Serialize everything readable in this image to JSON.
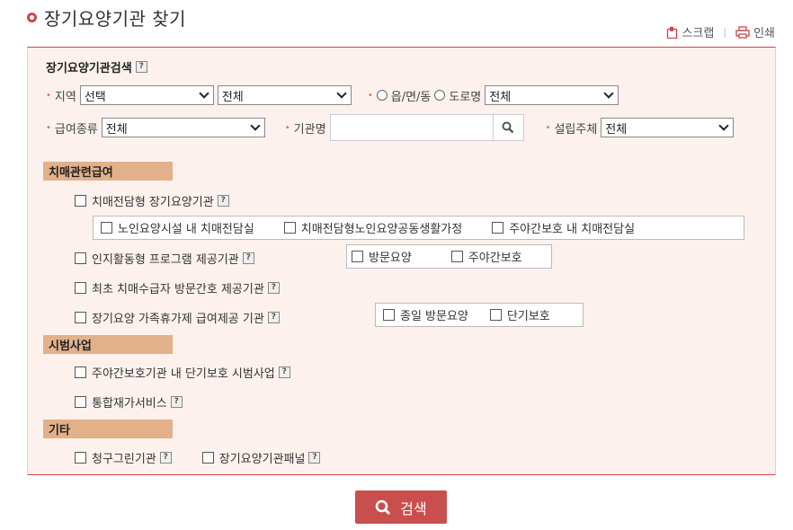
{
  "page": {
    "title": "장기요양기관 찾기",
    "scrap_label": "스크랩",
    "print_label": "인쇄"
  },
  "search_panel": {
    "heading": "장기요양기관검색",
    "region_label": "지역",
    "region_select": "선택",
    "district_select": "전체",
    "radio_town": "읍/면/동",
    "radio_road": "도로명",
    "address_select": "전체",
    "benefit_label": "급여종류",
    "benefit_select": "전체",
    "org_name_label": "기관명",
    "founder_label": "설립주체",
    "founder_select": "전체"
  },
  "dementia": {
    "section": "치매관련급여",
    "dedicated": "치매전담형 장기요양기관",
    "dedicated_sub": [
      "노인요양시설 내 치매전담실",
      "치매전담형노인요양공동생활가정",
      "주야간보호 내 치매전담실"
    ],
    "cognitive": "인지활동형 프로그램 제공기관",
    "cognitive_sub": [
      "방문요양",
      "주야간보호"
    ],
    "first_recipient": "최초 치매수급자 방문간호 제공기관",
    "family_rest": "장기요양 가족휴가제 급여제공 기관",
    "family_rest_sub": [
      "종일 방문요양",
      "단기보호"
    ]
  },
  "pilot": {
    "section": "시범사업",
    "items": [
      "주야간보호기관 내 단기보호 시범사업",
      "통합재가서비스"
    ]
  },
  "etc": {
    "section": "기타",
    "items": [
      "청구그린기관",
      "장기요양기관패널"
    ]
  },
  "submit_label": "검색",
  "colors": {
    "accent": "#c9474b",
    "section_bg": "#e2b18a",
    "panel_bg": "#fcf1ec",
    "button": "#c94f4e"
  }
}
